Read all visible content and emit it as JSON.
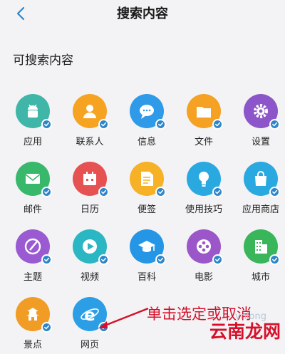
{
  "header": {
    "title": "搜索内容"
  },
  "section": {
    "title": "可搜索内容"
  },
  "items": [
    {
      "label": "应用",
      "color": "#3fb6a8",
      "icon": "android-icon"
    },
    {
      "label": "联系人",
      "color": "#f6a322",
      "icon": "contact-icon"
    },
    {
      "label": "信息",
      "color": "#2f9ae8",
      "icon": "message-icon"
    },
    {
      "label": "文件",
      "color": "#f4a124",
      "icon": "folder-icon"
    },
    {
      "label": "设置",
      "color": "#8c55c9",
      "icon": "gear-icon"
    },
    {
      "label": "邮件",
      "color": "#38b86b",
      "icon": "mail-icon"
    },
    {
      "label": "日历",
      "color": "#e65152",
      "icon": "calendar-icon"
    },
    {
      "label": "便签",
      "color": "#f6b126",
      "icon": "note-icon"
    },
    {
      "label": "使用技巧",
      "color": "#2aa8e0",
      "icon": "bulb-icon"
    },
    {
      "label": "应用商店",
      "color": "#2aa8e0",
      "icon": "shopping-bag-icon"
    },
    {
      "label": "主题",
      "color": "#9a5ad2",
      "icon": "brush-icon"
    },
    {
      "label": "视频",
      "color": "#2ab6c2",
      "icon": "play-icon"
    },
    {
      "label": "百科",
      "color": "#2596e6",
      "icon": "graduation-cap-icon"
    },
    {
      "label": "电影",
      "color": "#9b56c9",
      "icon": "film-reel-icon"
    },
    {
      "label": "城市",
      "color": "#39b55a",
      "icon": "building-icon"
    },
    {
      "label": "景点",
      "color": "#f19c25",
      "icon": "pagoda-icon"
    },
    {
      "label": "网页",
      "color": "#2c9ee6",
      "icon": "browser-e-icon"
    }
  ],
  "annotation": {
    "text": "单击选定或取消"
  },
  "watermark": {
    "big": "云南龙网",
    "small": "ynlong"
  },
  "colors": {
    "badge": "#2e86c9",
    "annotation": "#d6102a",
    "background": "#f3f3f5"
  }
}
